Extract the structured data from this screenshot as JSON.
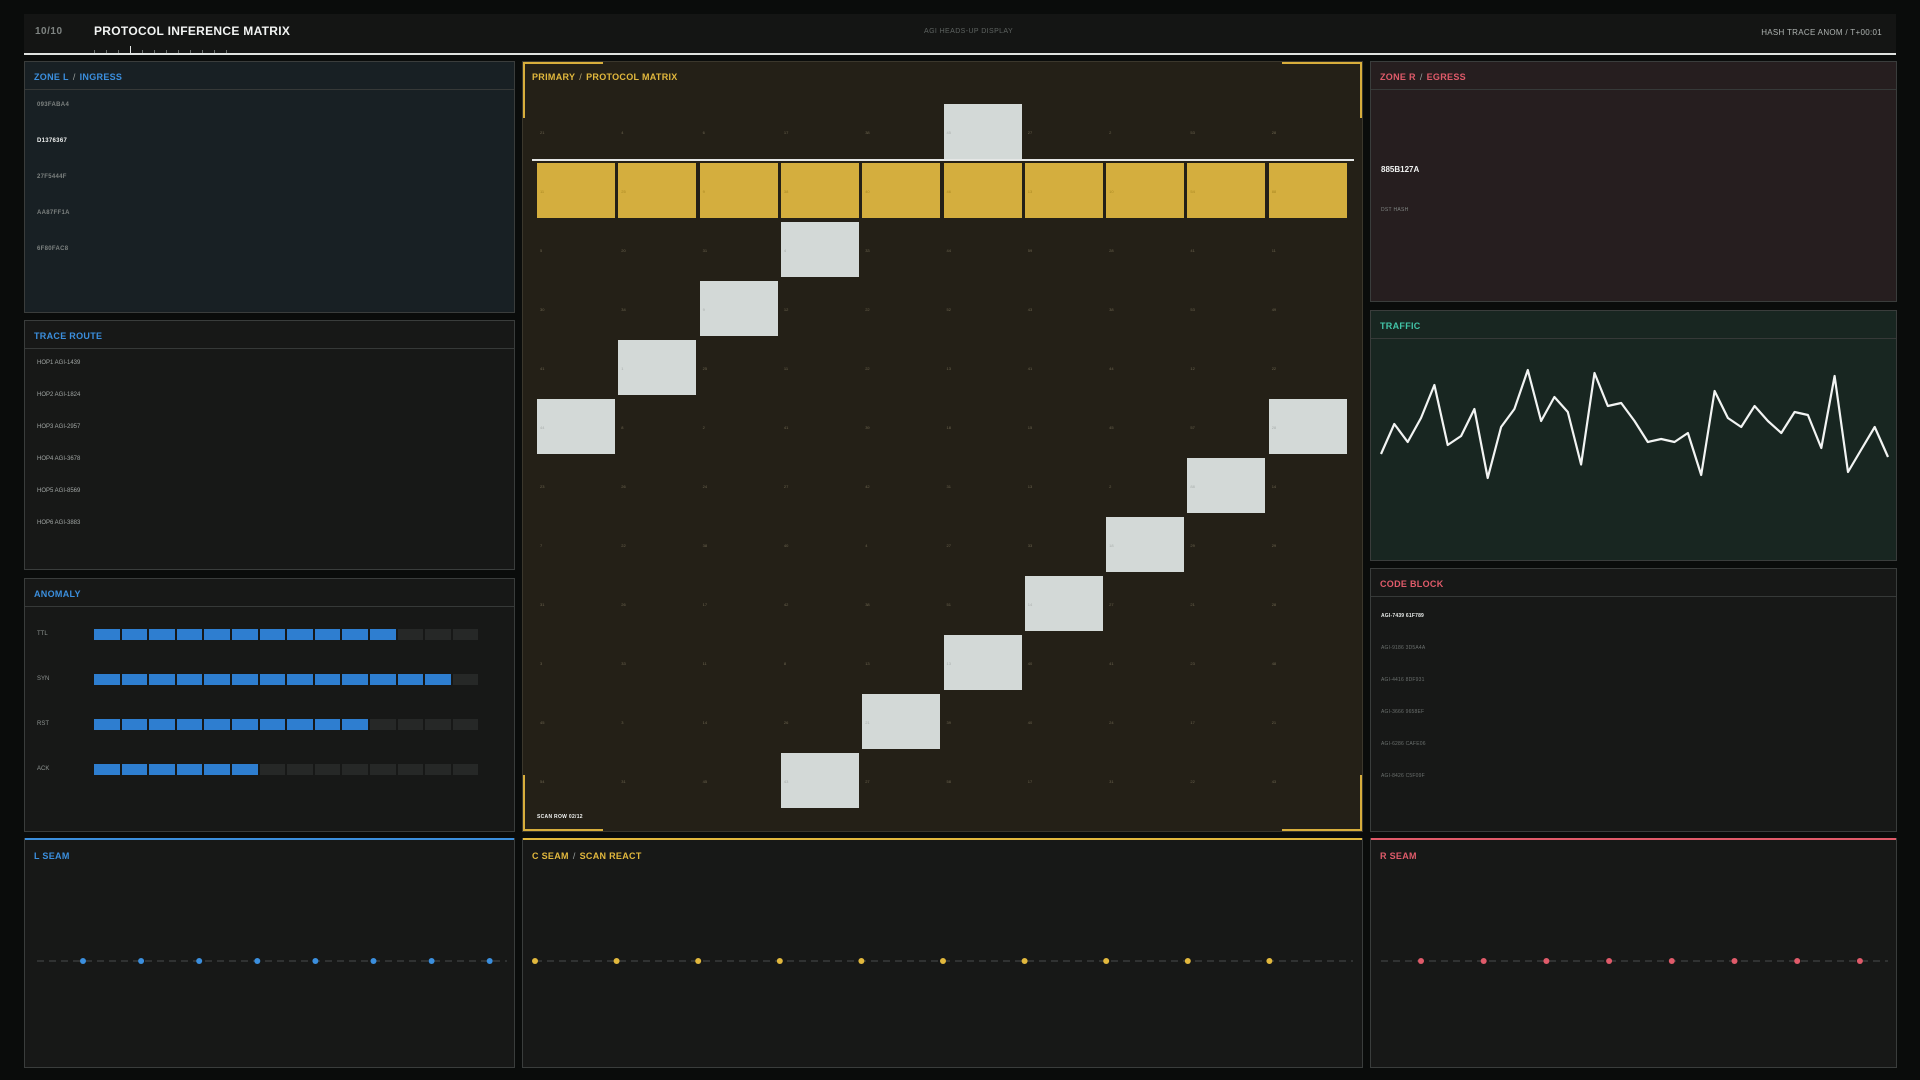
{
  "header": {
    "counter": "10/10",
    "title": "PROTOCOL INFERENCE MATRIX",
    "subtitle": "AGI HEADS-UP DISPLAY",
    "right": "HASH TRACE ANOM / T+00:01"
  },
  "zone_l": {
    "title_a": "ZONE L",
    "title_b": "INGRESS",
    "items": [
      "093FABA4",
      "D1376367",
      "27F5444F",
      "AA87FF1A",
      "6F80FAC8"
    ],
    "active_index": 1
  },
  "trace_route": {
    "title": "TRACE ROUTE",
    "hops": [
      "HOP1 AGI-1439",
      "HOP2 AGI-1824",
      "HOP3 AGI-2957",
      "HOP4 AGI-3678",
      "HOP5 AGI-8569",
      "HOP6 AGI-3883"
    ]
  },
  "anomaly": {
    "title": "ANOMALY",
    "total_segments": 14,
    "rows": [
      {
        "label": "TTL",
        "filled": 11
      },
      {
        "label": "SYN",
        "filled": 13
      },
      {
        "label": "RST",
        "filled": 10
      },
      {
        "label": "ACK",
        "filled": 6
      }
    ]
  },
  "zone_r": {
    "title_a": "ZONE R",
    "title_b": "EGRESS",
    "hash": "885B127A",
    "label": "DST HASH"
  },
  "traffic": {
    "title": "TRAFFIC",
    "values": [
      0.52,
      0.72,
      0.6,
      0.76,
      0.98,
      0.58,
      0.64,
      0.82,
      0.36,
      0.7,
      0.82,
      1.08,
      0.74,
      0.9,
      0.8,
      0.45,
      1.06,
      0.84,
      0.86,
      0.74,
      0.6,
      0.62,
      0.6,
      0.66,
      0.38,
      0.94,
      0.76,
      0.7,
      0.84,
      0.74,
      0.66,
      0.8,
      0.78,
      0.56,
      1.04,
      0.4,
      0.55,
      0.7,
      0.5
    ]
  },
  "code_block": {
    "title": "CODE BLOCK",
    "lines": [
      "AGI-7439 61F789",
      "AGI-9186 3D5A4A",
      "AGI-4416 8DF931",
      "AGI-3666 9658EF",
      "AGI-6286 CAFE06",
      "AGI-8426 C5F09F"
    ],
    "active_index": 0
  },
  "matrix": {
    "title_a": "PRIMARY",
    "title_b": "PROTOCOL MATRIX",
    "scan_label": "SCAN ROW 02/12",
    "scan_row": 1,
    "rows": 12,
    "cols": 10,
    "lit": [
      [
        0,
        5
      ],
      [
        2,
        3
      ],
      [
        3,
        2
      ],
      [
        4,
        1
      ],
      [
        5,
        0
      ],
      [
        5,
        9
      ],
      [
        6,
        8
      ],
      [
        7,
        7
      ],
      [
        8,
        6
      ],
      [
        9,
        5
      ],
      [
        10,
        4
      ],
      [
        11,
        3
      ]
    ],
    "numbers": [
      [
        "21",
        "4",
        "6",
        "17",
        "38",
        "45",
        "27",
        "2",
        "53",
        "28"
      ],
      [
        "11",
        "25",
        "9",
        "38",
        "40",
        "46",
        "13",
        "10",
        "54",
        "88"
      ],
      [
        "5",
        "20",
        "31",
        "4",
        "33",
        "44",
        "59",
        "28",
        "41",
        "11"
      ],
      [
        "30",
        "34",
        "9",
        "12",
        "22",
        "52",
        "43",
        "38",
        "53",
        "49"
      ],
      [
        "41",
        "1",
        "25",
        "11",
        "22",
        "13",
        "41",
        "44",
        "12",
        "22"
      ],
      [
        "44",
        "8",
        "2",
        "41",
        "39",
        "18",
        "15",
        "45",
        "57",
        "28"
      ],
      [
        "23",
        "26",
        "24",
        "27",
        "42",
        "31",
        "13",
        "2",
        "88",
        "14"
      ],
      [
        "7",
        "22",
        "38",
        "40",
        "4",
        "27",
        "33",
        "18",
        "29",
        "29"
      ],
      [
        "31",
        "26",
        "17",
        "42",
        "38",
        "51",
        "14",
        "27",
        "21",
        "28"
      ],
      [
        "3",
        "33",
        "11",
        "8",
        "13",
        "13",
        "40",
        "41",
        "23",
        "48"
      ],
      [
        "45",
        "3",
        "14",
        "26",
        "21",
        "39",
        "40",
        "24",
        "17",
        "21"
      ],
      [
        "54",
        "31",
        "45",
        "43",
        "27",
        "58",
        "17",
        "31",
        "22",
        "43"
      ]
    ]
  },
  "seams": {
    "left": {
      "title": "L SEAM",
      "color": "#3b8fde",
      "dots": 8
    },
    "center": {
      "title_a": "C SEAM",
      "title_b": "SCAN REACT",
      "color": "#e2b83d",
      "dots": 10
    },
    "right": {
      "title": "R SEAM",
      "color": "#e05b6a",
      "dots": 8
    }
  },
  "colors": {
    "blue": "#2e7ed0",
    "gold": "#d4ae3e",
    "red": "#e05b6a",
    "teal": "#42c4a8"
  }
}
